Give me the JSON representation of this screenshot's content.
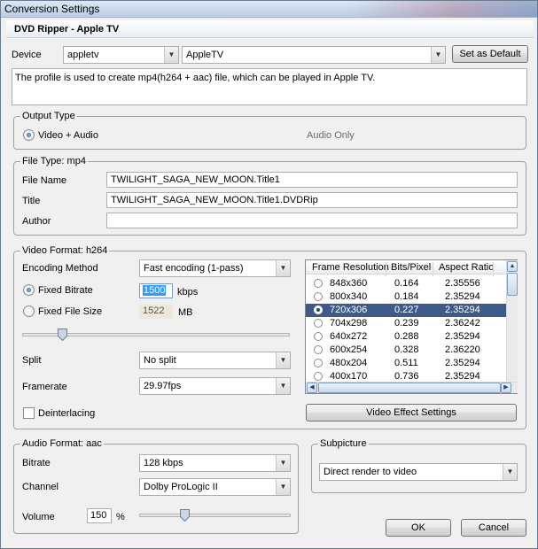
{
  "window": {
    "title": "Conversion Settings"
  },
  "header": {
    "title": "DVD Ripper - Apple TV"
  },
  "device": {
    "label": "Device",
    "category_value": "appletv",
    "profile_value": "AppleTV",
    "set_default_label": "Set as Default",
    "description": "The profile is used to create mp4(h264 + aac) file, which can be played in Apple TV."
  },
  "output_type": {
    "legend": "Output Type",
    "option_video_audio": "Video + Audio",
    "option_audio_only": "Audio Only",
    "selected": "Video + Audio"
  },
  "file_type": {
    "legend": "File Type: mp4",
    "file_name_label": "File Name",
    "file_name_value": "TWILIGHT_SAGA_NEW_MOON.Title1",
    "title_label": "Title",
    "title_value": "TWILIGHT_SAGA_NEW_MOON.Title1.DVDRip",
    "author_label": "Author",
    "author_value": ""
  },
  "video_format": {
    "legend": "Video Format: h264",
    "encoding_method_label": "Encoding Method",
    "encoding_method_value": "Fast encoding (1-pass)",
    "fixed_bitrate_label": "Fixed Bitrate",
    "fixed_bitrate_value": "1500",
    "bitrate_unit": "kbps",
    "fixed_file_size_label": "Fixed File Size",
    "fixed_file_size_value": "1522",
    "file_size_unit": "MB",
    "mode_selected": "Fixed Bitrate",
    "bitrate_slider_fraction": 0.15,
    "split_label": "Split",
    "split_value": "No split",
    "framerate_label": "Framerate",
    "framerate_value": "29.97fps",
    "deinterlacing_label": "Deinterlacing",
    "deinterlacing_checked": false,
    "effect_button_label": "Video Effect Settings",
    "resolution_table": {
      "columns": [
        "Frame Resolution",
        "Bits/Pixel",
        "Aspect Ratio"
      ],
      "rows": [
        {
          "res": "848x360",
          "bpp": "0.164",
          "ar": "2.35556",
          "selected": false
        },
        {
          "res": "800x340",
          "bpp": "0.184",
          "ar": "2.35294",
          "selected": false
        },
        {
          "res": "720x306",
          "bpp": "0.227",
          "ar": "2.35294",
          "selected": true
        },
        {
          "res": "704x298",
          "bpp": "0.239",
          "ar": "2.36242",
          "selected": false
        },
        {
          "res": "640x272",
          "bpp": "0.288",
          "ar": "2.35294",
          "selected": false
        },
        {
          "res": "600x254",
          "bpp": "0.328",
          "ar": "2.36220",
          "selected": false
        },
        {
          "res": "480x204",
          "bpp": "0.511",
          "ar": "2.35294",
          "selected": false
        },
        {
          "res": "400x170",
          "bpp": "0.736",
          "ar": "2.35294",
          "selected": false
        }
      ]
    }
  },
  "audio_format": {
    "legend": "Audio Format: aac",
    "bitrate_label": "Bitrate",
    "bitrate_value": "128 kbps",
    "channel_label": "Channel",
    "channel_value": "Dolby ProLogic II",
    "volume_label": "Volume",
    "volume_value": "150",
    "volume_unit": "%",
    "volume_slider_fraction": 0.3
  },
  "subpicture": {
    "legend": "Subpicture",
    "value": "Direct render to video"
  },
  "buttons": {
    "ok": "OK",
    "cancel": "Cancel"
  },
  "colors": {
    "selection": "#3d5a8a",
    "accent": "#1f5ea8"
  }
}
